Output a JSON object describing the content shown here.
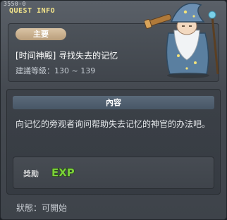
{
  "window": {
    "quest_id": "3550-0",
    "title": "QUEST INFO"
  },
  "quest": {
    "type_tag": "主要",
    "title": "[时间神殿] 寻找失去的记忆",
    "level_range": "建議等級：130 ~ 139"
  },
  "content": {
    "header": "內容",
    "description": "向记忆的旁观者询问帮助失去记忆的神官的办法吧。"
  },
  "reward": {
    "label": "獎勵",
    "exp_text": "EXP"
  },
  "status": {
    "text": "狀態：可開始"
  },
  "colors": {
    "title_yellow": "#f4e58a",
    "tag_tan": "#c9b08d",
    "exp_green": "#7bd13a"
  },
  "icons": {
    "npc": "wizard-sage-npc-illustration",
    "exp": "exp-reward-icon"
  }
}
